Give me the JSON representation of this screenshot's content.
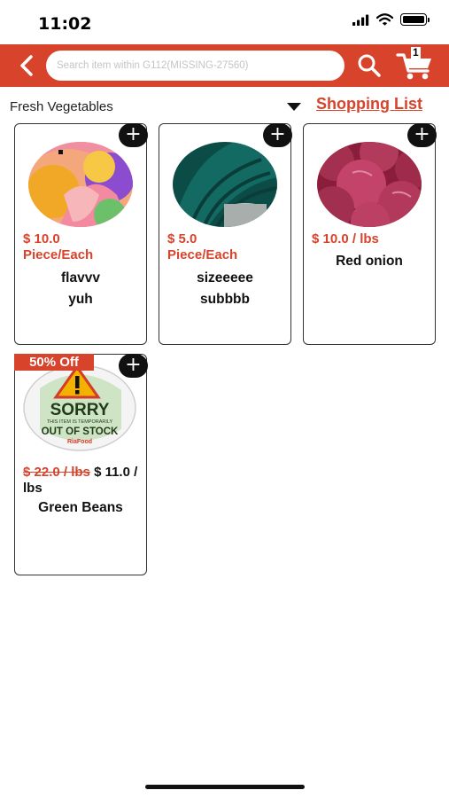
{
  "status_bar": {
    "time": "11:02"
  },
  "header": {
    "search_placeholder": "Search item within G112(MISSING-27560)",
    "cart_count": "1"
  },
  "category": {
    "name": "Fresh Vegetables",
    "shopping_list_label": "Shopping List"
  },
  "colors": {
    "brand": "#d8432b",
    "text": "#111111",
    "card_border": "#333333"
  },
  "icons": [
    "back-arrow-icon",
    "search-icon",
    "cart-icon",
    "dropdown-triangle-icon",
    "plus-icon"
  ],
  "products": [
    {
      "price": "$ 10.0",
      "unit": "Piece/Each",
      "name": "flavvv",
      "subname": "yuh",
      "add_label": "+"
    },
    {
      "price": "$ 5.0",
      "unit": "Piece/Each",
      "name": "sizeeeee",
      "subname": "subbbb",
      "add_label": "+"
    },
    {
      "price": "$ 10.0  / lbs",
      "name": "Red onion",
      "add_label": "+"
    },
    {
      "discount": "50% Off",
      "old_price": "$ 22.0  / lbs",
      "new_price": "$ 11.0  / lbs",
      "name": "Green Beans",
      "add_label": "+",
      "image_text": {
        "sorry": "SORRY",
        "line1": "THIS ITEM IS TEMPORARILY",
        "line2": "OUT OF STOCK",
        "brand": "RiaFood"
      }
    }
  ]
}
